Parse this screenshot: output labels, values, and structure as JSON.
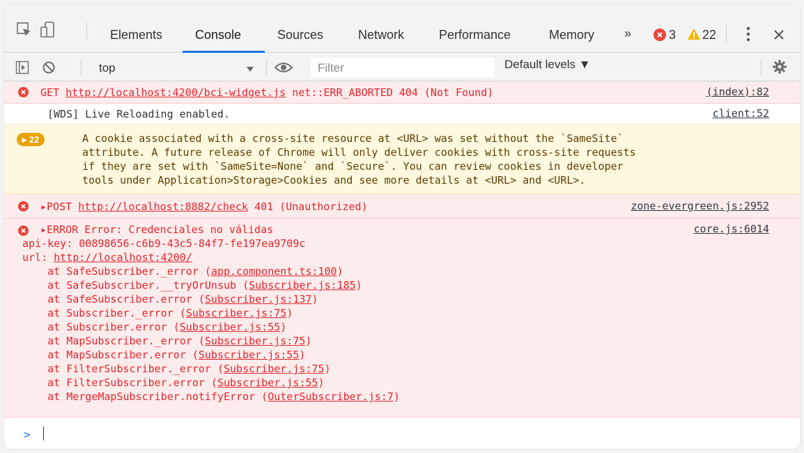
{
  "tabs": {
    "items": [
      "Elements",
      "Console",
      "Sources",
      "Network",
      "Performance",
      "Memory"
    ],
    "more_label": "»",
    "error_count": "3",
    "warning_count": "22"
  },
  "toolbar": {
    "context": "top",
    "filter_placeholder": "Filter",
    "levels": "Default levels ▼"
  },
  "console": {
    "lines": [
      {
        "type": "error",
        "method": "GET",
        "url": "http://localhost:4200/bci-widget.js",
        "status": "net::ERR_ABORTED 404 (Not Found)",
        "source": "(index):82"
      },
      {
        "type": "info",
        "text": "[WDS] Live Reloading enabled.",
        "source": "client:52"
      },
      {
        "type": "warning",
        "count": "22",
        "text": [
          "A cookie associated with a cross-site resource at <URL> was set without the `SameSite`",
          "attribute. A future release of Chrome will only deliver cookies with cross-site requests",
          "if they are set with `SameSite=None` and `Secure`. You can review cookies in developer",
          "tools under Application>Storage>Cookies and see more details at <URL> and <URL>."
        ]
      },
      {
        "type": "error",
        "method": "▸POST",
        "url": "http://localhost:8882/check",
        "status": "401 (Unauthorized)",
        "source": "zone-evergreen.js:2952"
      },
      {
        "type": "error",
        "header": "▸ERROR Error: Credenciales no válidas",
        "source": "core.js:6014",
        "api_key": "api-key: 00898656-c6b9-43c5-84f7-fe197ea9709c",
        "url_label": "url: ",
        "url": "http://localhost:4200/",
        "stack": [
          {
            "fn": "    at SafeSubscriber._error (",
            "file": "app.component.ts:100",
            "close": ")"
          },
          {
            "fn": "    at SafeSubscriber.__tryOrUnsub (",
            "file": "Subscriber.js:185",
            "close": ")"
          },
          {
            "fn": "    at SafeSubscriber.error (",
            "file": "Subscriber.js:137",
            "close": ")"
          },
          {
            "fn": "    at Subscriber._error (",
            "file": "Subscriber.js:75",
            "close": ")"
          },
          {
            "fn": "    at Subscriber.error (",
            "file": "Subscriber.js:55",
            "close": ")"
          },
          {
            "fn": "    at MapSubscriber._error (",
            "file": "Subscriber.js:75",
            "close": ")"
          },
          {
            "fn": "    at MapSubscriber.error (",
            "file": "Subscriber.js:55",
            "close": ")"
          },
          {
            "fn": "    at FilterSubscriber._error (",
            "file": "Subscriber.js:75",
            "close": ")"
          },
          {
            "fn": "    at FilterSubscriber.error (",
            "file": "Subscriber.js:55",
            "close": ")"
          },
          {
            "fn": "    at MergeMapSubscriber.notifyError (",
            "file": "OuterSubscriber.js:7",
            "close": ")"
          }
        ]
      }
    ],
    "prompt": ">"
  },
  "colors": {
    "accent": "#1a73e8",
    "error": "#e3262f",
    "warning": "#e8a200"
  }
}
